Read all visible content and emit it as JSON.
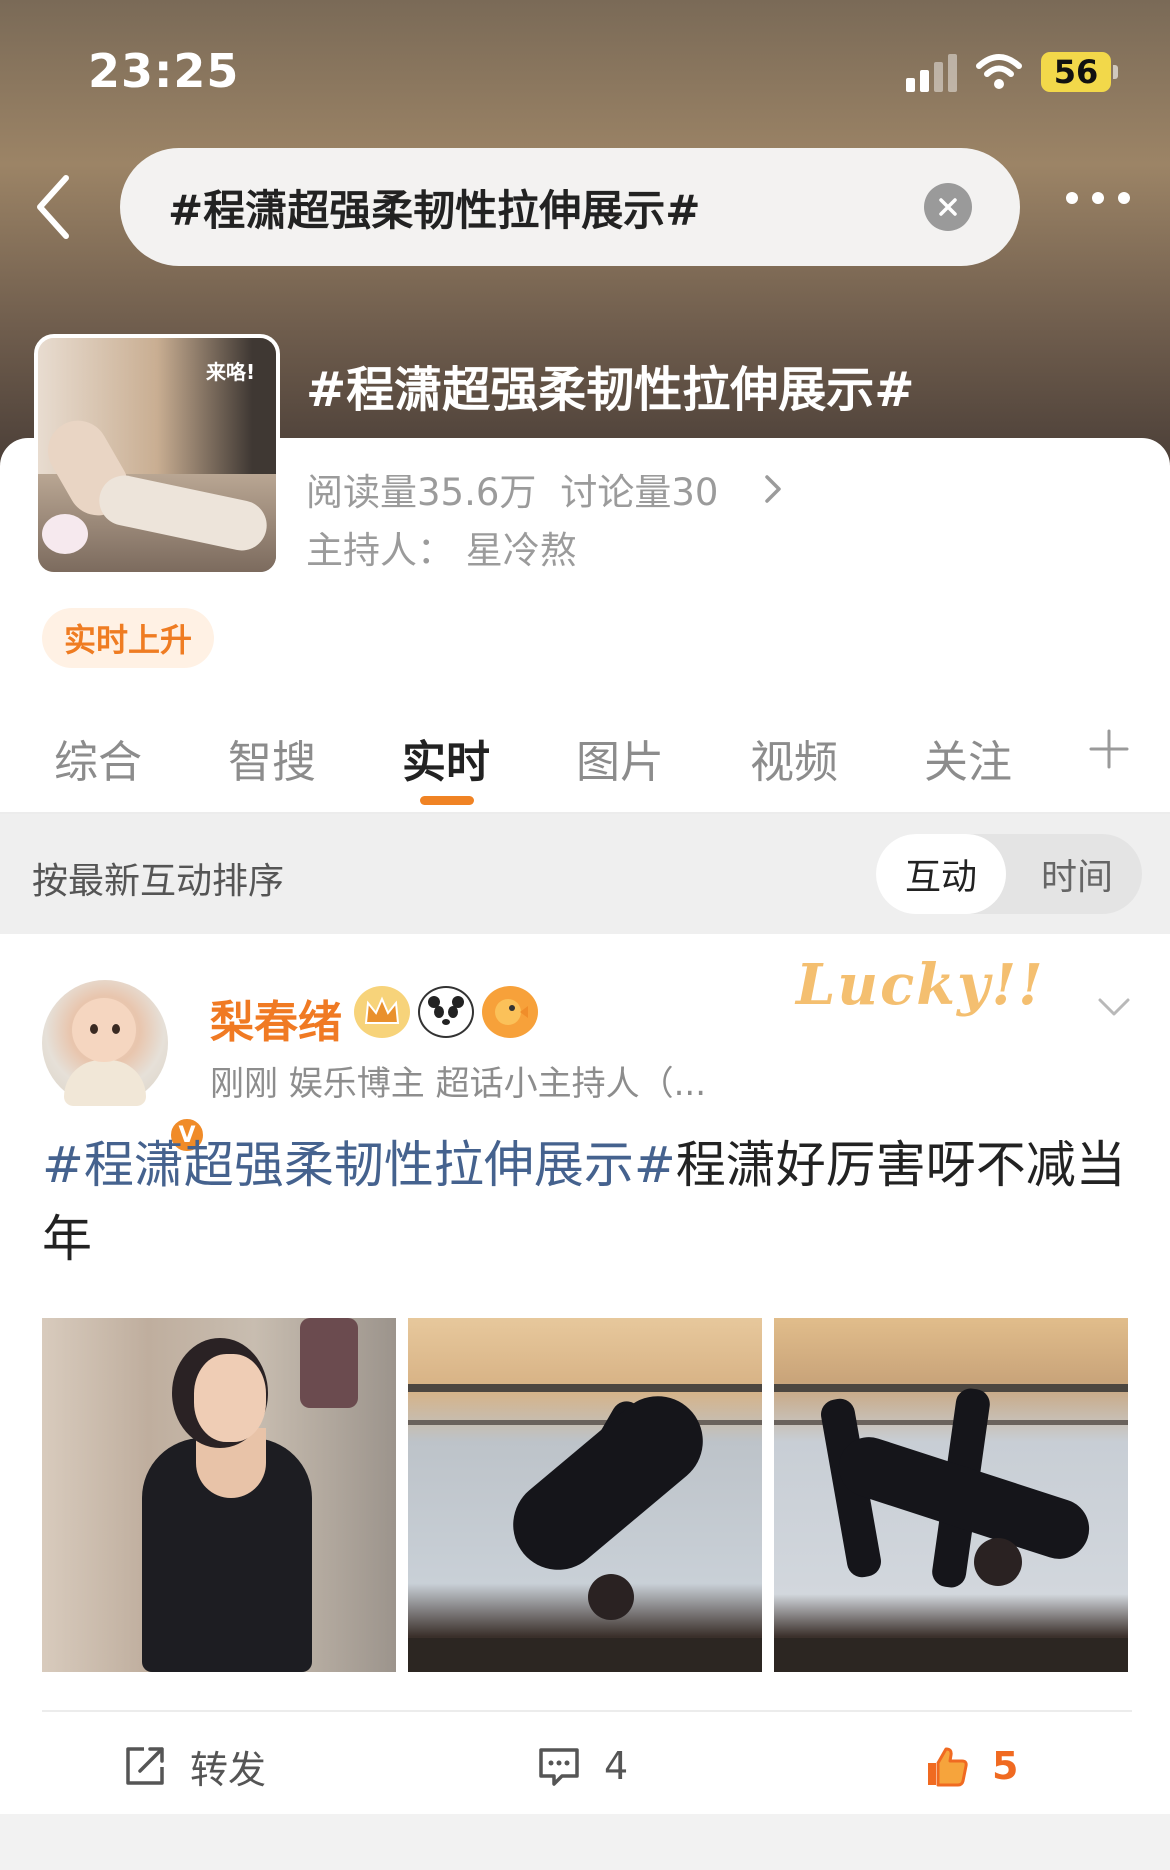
{
  "status_bar": {
    "time": "23:25",
    "battery": "56"
  },
  "header": {
    "search_value": "#程潇超强柔韧性拉伸展示#",
    "icons": {
      "back": "back-chevron-icon",
      "clear": "clear-circle-icon",
      "more": "more-dots-icon"
    }
  },
  "topic": {
    "title": "#程潇超强柔韧性拉伸展示#",
    "reads": "阅读量35.6万",
    "discussions": "讨论量30",
    "host": "主持人：  星冷熬",
    "thumbnail_sticker": "来咯!",
    "rising_badge": "实时上升"
  },
  "tabs": [
    {
      "label": "综合",
      "active": false
    },
    {
      "label": "智搜",
      "active": false
    },
    {
      "label": "实时",
      "active": true
    },
    {
      "label": "图片",
      "active": false
    },
    {
      "label": "视频",
      "active": false
    },
    {
      "label": "关注",
      "active": false
    }
  ],
  "sort": {
    "label": "按最新互动排序",
    "options": [
      "互动",
      "时间"
    ],
    "selected": "互动"
  },
  "post": {
    "username": "梨春绪",
    "meta": "刚刚   娱乐博主 超话小主持人（...",
    "decoration": "Lucky!!",
    "verified_mark": "V",
    "text_hashtag": "#程潇超强柔韧性拉伸展示#",
    "text_body": "程潇好厉害呀不减当年",
    "actions": {
      "repost": "转发",
      "comments": "4",
      "likes": "5"
    }
  },
  "colors": {
    "accent": "#f07a23",
    "hashtag": "#45628e",
    "like": "#f06a21"
  }
}
